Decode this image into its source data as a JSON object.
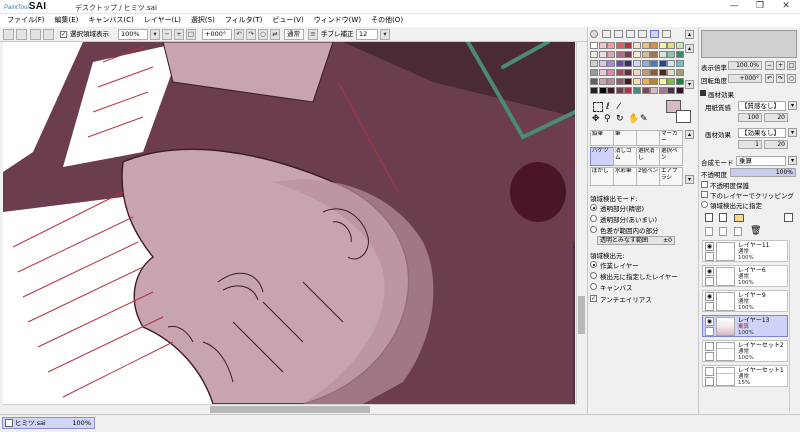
{
  "app": {
    "logo_small": "PaintTool",
    "logo_big": "SAI",
    "document_title": "デスクトップ / ヒミツ.sai"
  },
  "window_buttons": {
    "minimize": "—",
    "maximize": "❐",
    "close": "✕"
  },
  "menu": [
    "ファイル(F)",
    "編集(E)",
    "キャンバス(C)",
    "レイヤー(L)",
    "選択(S)",
    "フィルタ(T)",
    "ビュー(V)",
    "ウィンドウ(W)",
    "その他(O)"
  ],
  "toolbar": {
    "selection_toggle_label": "選択領域表示",
    "selection_toggle_checked": true,
    "zoom": "100%",
    "angle": "+000°",
    "blend": "通常",
    "stabilizer_label": "手ブレ補正",
    "stabilizer_value": "12"
  },
  "status": {
    "filename": "ヒミツ.sai",
    "zoom": "100%"
  },
  "colors": {
    "canvas_bg": "#6b3d4e",
    "skin": "#c8a4af",
    "line": "#3a1b27",
    "accent_red": "#b83040",
    "teal": "#4a8a7a",
    "selection": "#cfd3f7",
    "current_color": "#d7b9c2"
  },
  "tools": {
    "header": [
      "鉛筆",
      "筆",
      "マーカー"
    ],
    "rows": [
      [
        "バケツ",
        "消しゴム",
        "選択消し",
        "選択ペン"
      ],
      [
        "ぼかし",
        "水彩筆",
        "2値ペン",
        "エアブラシ"
      ]
    ]
  },
  "bucket_options": {
    "mode_label": "領域検出モード:",
    "modes": [
      "透明部分(精密)",
      "透明部分(あいまい)",
      "色差が範囲内の部分"
    ],
    "selected_mode": 0,
    "range_label": "透明とみなす範囲",
    "range_value": "±0",
    "source_label": "領域検出元:",
    "sources": [
      "作業レイヤー",
      "検出元に指定したレイヤー",
      "キャンバス"
    ],
    "selected_source": 0,
    "antialias_label": "アンチエイリアス",
    "antialias_checked": true
  },
  "navigator": {
    "zoom_label": "表示倍率",
    "zoom_value": "100.0%",
    "angle_label": "回転角度",
    "angle_value": "+000°"
  },
  "paper": {
    "section_title": "画材効果",
    "texture_label": "用紙質感",
    "texture_value": "【質感なし】",
    "texture_slider": "100",
    "texture_slider2": "20",
    "effect_label": "画材効果",
    "effect_value": "【効果なし】",
    "effect_slider": "1",
    "effect_slider2": "20"
  },
  "layer_props": {
    "blend_label": "合成モード",
    "blend_value": "乗算",
    "opacity_label": "不透明度",
    "opacity_value": "100%",
    "options": [
      "不透明度保護",
      "下のレイヤーでクリッピング",
      "領域検出元に指定"
    ]
  },
  "layers": [
    {
      "name": "レイヤー11",
      "mode": "通常",
      "opacity": "100%",
      "selected": false,
      "folder": false,
      "visible": true
    },
    {
      "name": "レイヤー6",
      "mode": "通常",
      "opacity": "100%",
      "selected": false,
      "folder": false,
      "visible": true
    },
    {
      "name": "レイヤー9",
      "mode": "通常",
      "opacity": "100%",
      "selected": false,
      "folder": false,
      "visible": true
    },
    {
      "name": "レイヤー13",
      "mode": "乗算",
      "opacity": "100%",
      "selected": true,
      "folder": false,
      "visible": true
    },
    {
      "name": "レイヤーセット2",
      "mode": "通常",
      "opacity": "100%",
      "selected": false,
      "folder": true,
      "visible": false
    },
    {
      "name": "レイヤーセット1",
      "mode": "通常",
      "opacity": "15%",
      "selected": false,
      "folder": true,
      "visible": false
    }
  ]
}
